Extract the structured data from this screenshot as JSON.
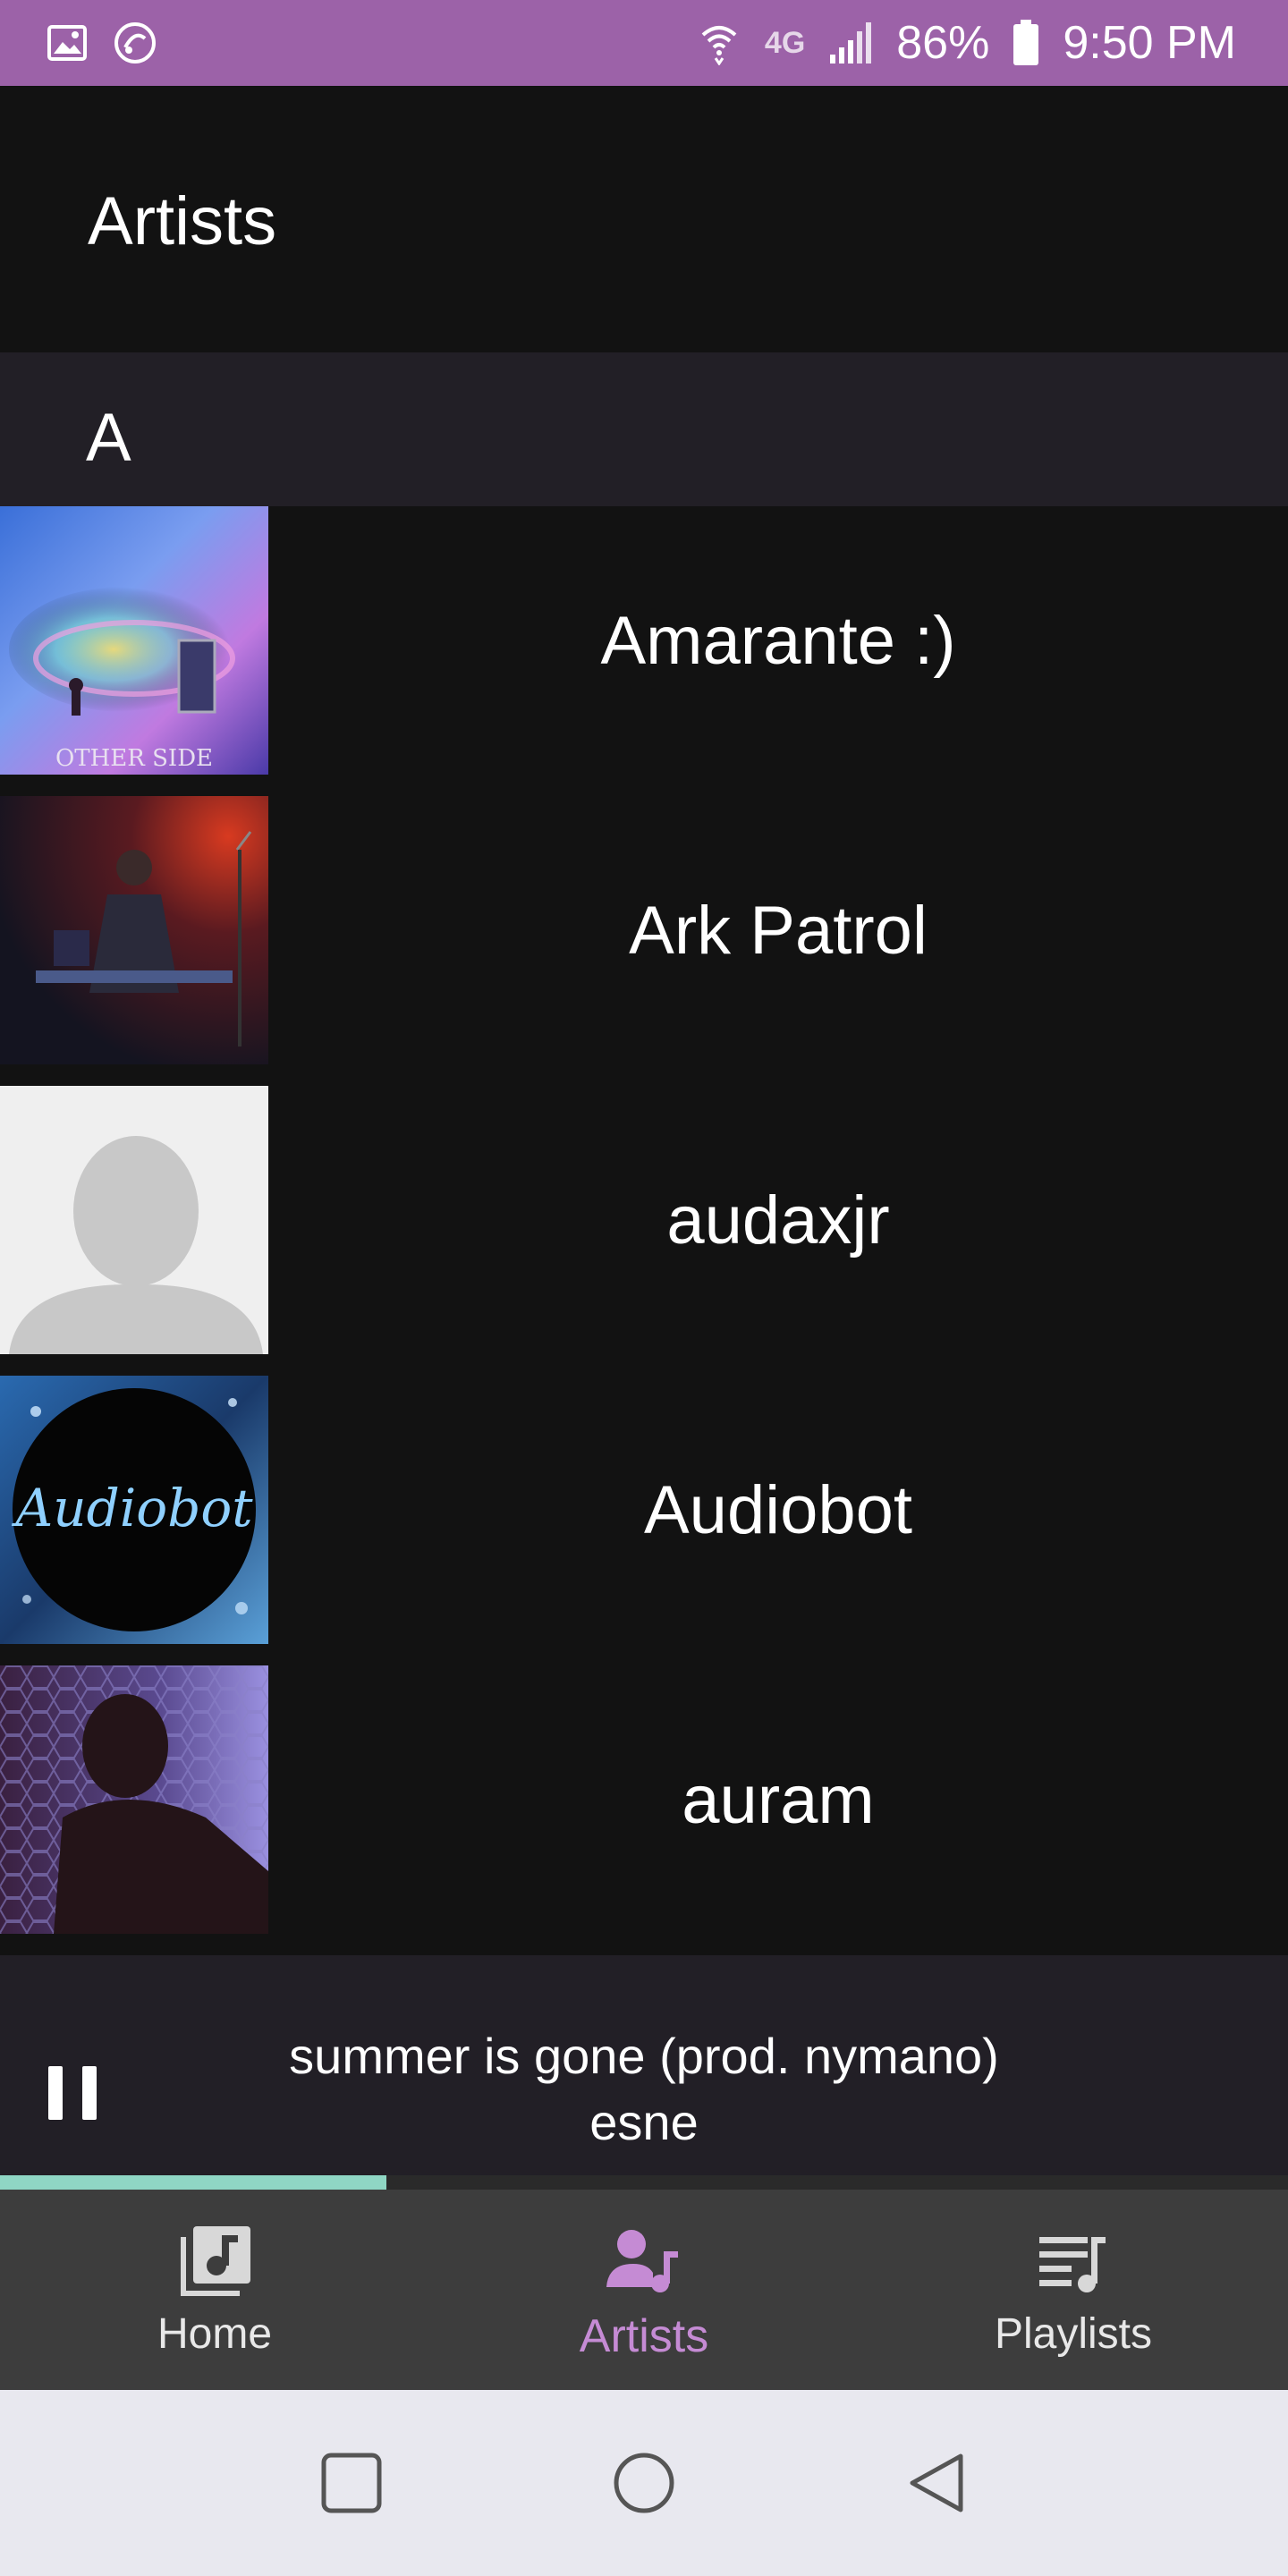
{
  "status_bar": {
    "battery": "86%",
    "time": "9:50 PM",
    "network": "4G",
    "icons": [
      "image-icon",
      "sync-icon",
      "wifi-icon",
      "signal-icon",
      "battery-icon"
    ]
  },
  "header": {
    "title": "Artists"
  },
  "section": {
    "letter": "A"
  },
  "artists": [
    {
      "name": "Amarante :)",
      "thumb": "album-art"
    },
    {
      "name": "Ark Patrol",
      "thumb": "performer-photo"
    },
    {
      "name": "audaxjr",
      "thumb": "default-avatar"
    },
    {
      "name": "Audiobot",
      "thumb": "audiobot-logo",
      "thumb_text": "Audiobot"
    },
    {
      "name": "auram",
      "thumb": "silhouette-photo"
    }
  ],
  "now_playing": {
    "title": "summer is gone (prod. nymano)",
    "artist": "esne",
    "progress": 0.3
  },
  "bottom_nav": {
    "items": [
      {
        "label": "Home",
        "icon": "music-library-icon",
        "active": false
      },
      {
        "label": "Artists",
        "icon": "artist-icon",
        "active": true
      },
      {
        "label": "Playlists",
        "icon": "playlist-icon",
        "active": false
      }
    ]
  },
  "colors": {
    "status_bar": "#9c62a8",
    "accent": "#c58bd4",
    "progress": "#8fd6c4",
    "background": "#121212",
    "section": "#221f26"
  }
}
